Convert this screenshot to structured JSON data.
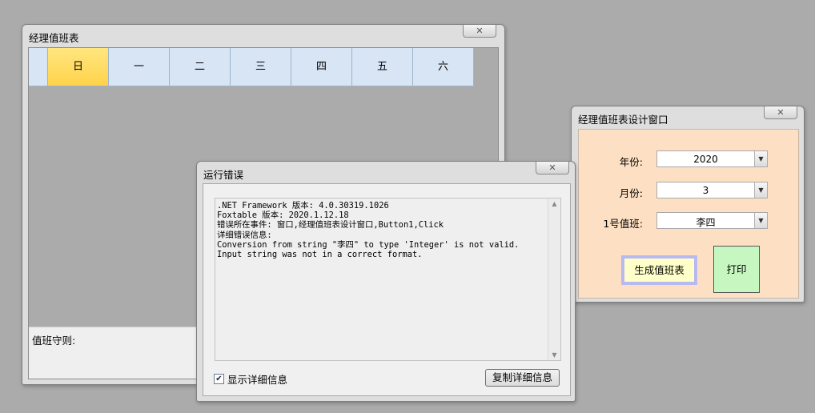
{
  "schedule_window": {
    "title": "经理值班表",
    "close_glyph": "✕",
    "days": [
      {
        "label": "日",
        "active": true
      },
      {
        "label": "一",
        "active": false
      },
      {
        "label": "二",
        "active": false
      },
      {
        "label": "三",
        "active": false
      },
      {
        "label": "四",
        "active": false
      },
      {
        "label": "五",
        "active": false
      },
      {
        "label": "六",
        "active": false
      }
    ],
    "rules_label": "值班守则:"
  },
  "error_dialog": {
    "title": "运行错误",
    "close_glyph": "✕",
    "details": [
      ".NET Framework 版本: 4.0.30319.1026",
      "Foxtable 版本: 2020.1.12.18",
      "错误所在事件: 窗口,经理值班表设计窗口,Button1,Click",
      "详细错误信息:",
      "Conversion from string \"李四\" to type 'Integer' is not valid.",
      "Input string was not in a correct format."
    ],
    "show_details_checked": true,
    "show_details_label": "显示详细信息",
    "copy_button_label": "复制详细信息"
  },
  "design_window": {
    "title": "经理值班表设计窗口",
    "close_glyph": "✕",
    "fields": {
      "year": {
        "label": "年份:",
        "value": "2020"
      },
      "month": {
        "label": "月份:",
        "value": "3"
      },
      "duty": {
        "label": "1号值班:",
        "value": "李四"
      }
    },
    "generate_button_label": "生成值班表",
    "print_button_label": "打印"
  },
  "colors": {
    "desktop": "#ababab",
    "active_day": "#ffd34a",
    "day_header": "#d7e5f4",
    "design_panel": "#fde0c3",
    "generate_button": "#ffffc9",
    "print_button": "#c7f7c1"
  }
}
